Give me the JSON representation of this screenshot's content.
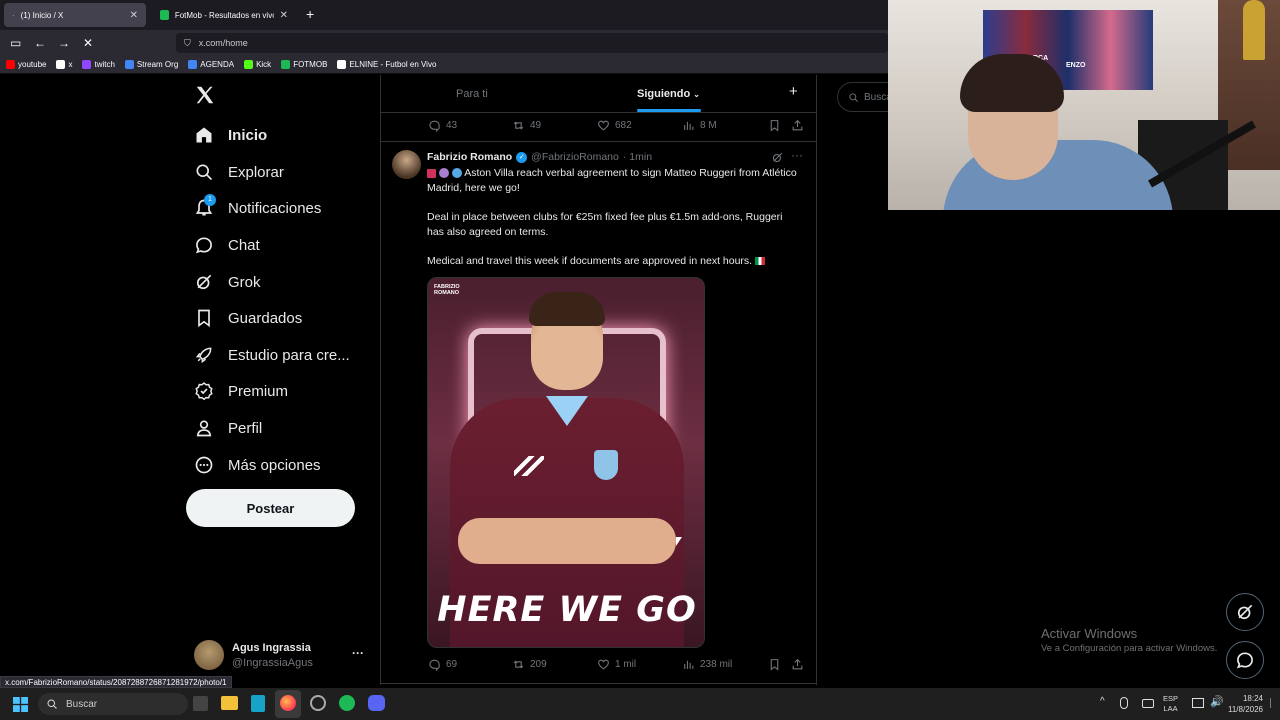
{
  "browser": {
    "tabs": [
      {
        "title": "(1) Inicio / X"
      },
      {
        "title": "FotMob - Resultados en vivo de"
      }
    ],
    "url": "x.com/home",
    "bookmarks": [
      "youtube",
      "x",
      "twitch",
      "Stream Org",
      "AGENDA",
      "Kick",
      "FOTMOB",
      "ELNINE - Futbol en Vivo"
    ],
    "status_url": "x.com/FabrizioRomano/status/2087288726871281972/photo/1"
  },
  "sidebar": {
    "items": [
      {
        "label": "Inicio"
      },
      {
        "label": "Explorar"
      },
      {
        "label": "Notificaciones",
        "badge": "1"
      },
      {
        "label": "Chat"
      },
      {
        "label": "Grok"
      },
      {
        "label": "Guardados"
      },
      {
        "label": "Estudio para cre..."
      },
      {
        "label": "Premium"
      },
      {
        "label": "Perfil"
      },
      {
        "label": "Más opciones"
      }
    ],
    "post_label": "Postear",
    "account": {
      "name": "Agus Ingrassia",
      "handle": "@IngrassiaAgus",
      "more": "···"
    }
  },
  "feed": {
    "tabs": [
      {
        "label": "Para ti"
      },
      {
        "label": "Siguiendo"
      }
    ],
    "plus": "+",
    "prev_stats": {
      "replies": "43",
      "reposts": "49",
      "likes": "682",
      "views": "8 M"
    },
    "tweet": {
      "name": "Fabrizio Romano",
      "handle": "@FabrizioRomano",
      "time": "· 1min",
      "text1": "Aston Villa reach verbal agreement to sign Matteo Ruggeri from Atlético Madrid, here we go!",
      "text2": "Deal in place between clubs for €25m fixed fee plus €1.5m add-ons, Ruggeri has also agreed on terms.",
      "text3": "Medical and travel this week if documents are approved in next hours.",
      "image_brand": "FABRIZIO ROMANO",
      "image_caption": "HERE WE GO",
      "stats": {
        "replies": "69",
        "reposts": "209",
        "likes": "1 mil",
        "views": "238 mil"
      }
    }
  },
  "search": {
    "placeholder": "Busca"
  },
  "watermark": {
    "title": "Activar Windows",
    "subtitle": "Ve a Configuración para activar Windows."
  },
  "taskbar": {
    "search": "Buscar",
    "lang1": "ESP",
    "lang2": "LAA",
    "time": "18:24",
    "date": "11/8/2026"
  },
  "webcam": {
    "shirt_label": "ENZO",
    "shirt_label2": "RCA"
  }
}
